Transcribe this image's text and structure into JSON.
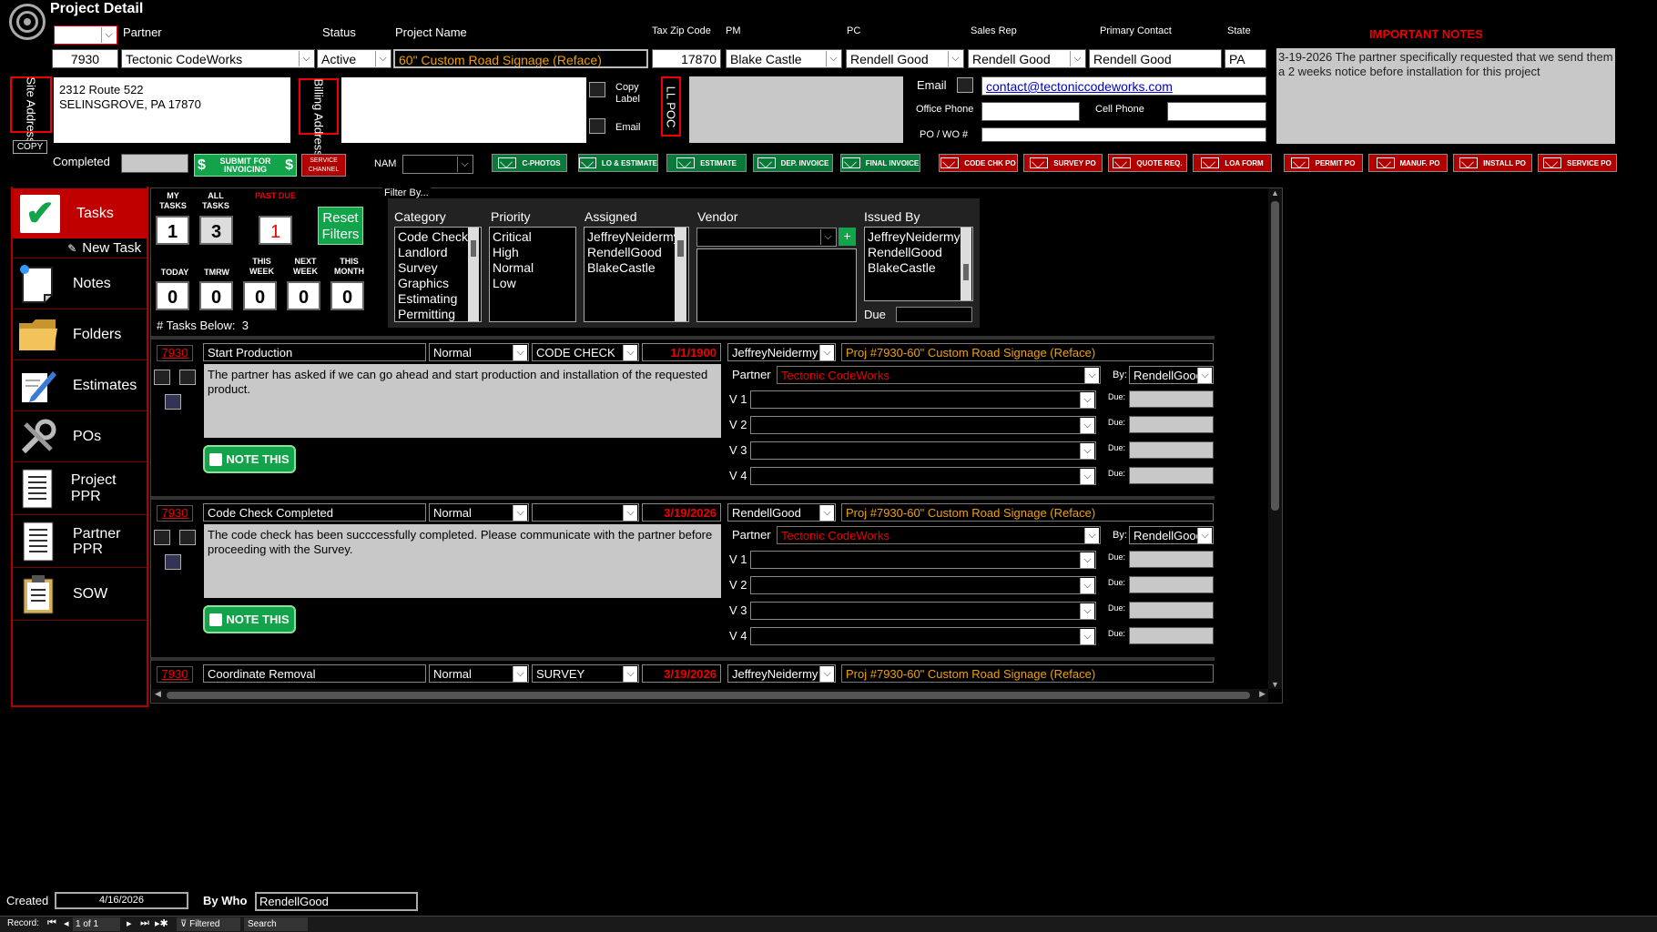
{
  "window": {
    "title": "Project Detail"
  },
  "header": {
    "partner_label": "Partner",
    "status_label": "Status",
    "project_name_label": "Project Name",
    "tax_zip_label": "Tax Zip Code",
    "pm_label": "PM",
    "pc_label": "PC",
    "sales_rep_label": "Sales Rep",
    "primary_contact_label": "Primary Contact",
    "state_label": "State",
    "project_id": "7930",
    "partner": "Tectonic CodeWorks",
    "status": "Active",
    "project_name": "60\" Custom Road Signage (Reface)",
    "tax_zip": "17870",
    "pm": "Blake Castle",
    "pc": "Rendell Good",
    "sales_rep": "Rendell Good",
    "primary_contact": "Rendell Good",
    "state": "PA"
  },
  "address": {
    "site_label": "Site Address",
    "billing_label": "Billing Address",
    "site_line1": "2312 Route 522",
    "site_line2": "SELINSGROVE, PA 17870",
    "copy_label": "COPY",
    "copy_label_btn": "Copy Label",
    "email_btn": "Email",
    "ll_poc": "LL POC"
  },
  "contact": {
    "email_label": "Email",
    "email": "contact@tectoniccodeworks.com",
    "office_phone_label": "Office Phone",
    "cell_phone_label": "Cell Phone",
    "po_label": "PO / WO #"
  },
  "notes": {
    "title": "IMPORTANT NOTES",
    "text": "3-19-2026 The partner specifically requested that we send them a 2 weeks notice before installation for this project"
  },
  "completion": {
    "completed_label": "Completed",
    "submit_label": "SUBMIT FOR INVOICING",
    "service_channel": "SERVICE CHANNEL",
    "nam_label": "NAM"
  },
  "email_buttons_green": [
    "C-PHOTOS",
    "LO & ESTIMATE",
    "ESTIMATE",
    "DEP. INVOICE",
    "FINAL INVOICE"
  ],
  "email_buttons_red": [
    "CODE CHK PO",
    "SURVEY PO",
    "QUOTE REQ.",
    "LOA FORM",
    "PERMIT PO",
    "MANUF. PO",
    "INSTALL PO",
    "SERVICE PO"
  ],
  "sidebar": {
    "items": [
      {
        "label": "Tasks"
      },
      {
        "label": "New Task"
      },
      {
        "label": "Notes"
      },
      {
        "label": "Folders"
      },
      {
        "label": "Estimates"
      },
      {
        "label": "POs"
      },
      {
        "label": "Project PPR"
      },
      {
        "label": "Partner PPR"
      },
      {
        "label": "SOW"
      }
    ]
  },
  "counters": {
    "my_tasks_label": "MY TASKS",
    "all_tasks_label": "ALL TASKS",
    "past_due_label": "PAST DUE",
    "my_tasks": "1",
    "all_tasks": "3",
    "past_due": "1",
    "reset_label": "Reset Filters",
    "today_label": "TODAY",
    "tmrw_label": "TMRW",
    "this_week_label": "THIS WEEK",
    "next_week_label": "NEXT WEEK",
    "this_month_label": "THIS MONTH",
    "today": "0",
    "tmrw": "0",
    "this_week": "0",
    "next_week": "0",
    "this_month": "0",
    "tasks_below_label": "# Tasks Below:",
    "tasks_below": "3"
  },
  "filter": {
    "title": "Filter By...",
    "category_label": "Category",
    "priority_label": "Priority",
    "assigned_label": "Assigned",
    "vendor_label": "Vendor",
    "issued_by_label": "Issued By",
    "due_label": "Due",
    "categories": [
      "Code Check",
      "Landlord",
      "Survey",
      "Graphics",
      "Estimating",
      "Permitting"
    ],
    "priorities": [
      "Critical",
      "High",
      "Normal",
      "Low"
    ],
    "assigned": [
      "JeffreyNeidermy",
      "RendellGood",
      "BlakeCastle"
    ],
    "issued_by": [
      "JeffreyNeidermy",
      "RendellGood",
      "BlakeCastle"
    ]
  },
  "tasks": [
    {
      "id": "7930",
      "title": "Start Production",
      "priority": "Normal",
      "category": "CODE CHECK",
      "date": "1/1/1900",
      "assigned": "JeffreyNeidermy",
      "project": "Proj #7930-60\" Custom Road Signage (Reface)",
      "text": "The partner has asked if we can go ahead and start production and installation of the requested product.",
      "partner_label": "Partner",
      "partner": "Tectonic CodeWorks",
      "by_label": "By:",
      "by": "RendellGood",
      "v1": "V 1",
      "v2": "V 2",
      "v3": "V 3",
      "v4": "V 4",
      "due": "Due:",
      "note_btn": "NOTE THIS"
    },
    {
      "id": "7930",
      "title": "Code Check Completed",
      "priority": "Normal",
      "category": "",
      "date": "3/19/2026",
      "assigned": "RendellGood",
      "project": "Proj #7930-60\" Custom Road Signage (Reface)",
      "text": "The code check has been succcessfully completed. Please communicate with the partner before proceeding with the Survey.",
      "partner_label": "Partner",
      "partner": "Tectonic CodeWorks",
      "by_label": "By:",
      "by": "RendellGood",
      "v1": "V 1",
      "v2": "V 2",
      "v3": "V 3",
      "v4": "V 4",
      "due": "Due:",
      "note_btn": "NOTE THIS"
    },
    {
      "id": "7930",
      "title": "Coordinate Removal",
      "priority": "Normal",
      "category": "SURVEY",
      "date": "3/19/2026",
      "assigned": "JeffreyNeidermy",
      "project": "Proj #7930-60\" Custom Road Signage (Reface)"
    }
  ],
  "footer": {
    "created_label": "Created",
    "created": "4/16/2026",
    "by_who_label": "By Who",
    "by_who": "RendellGood",
    "record_label": "Record:",
    "record": "1 of 1",
    "filtered": "Filtered",
    "search": "Search"
  }
}
